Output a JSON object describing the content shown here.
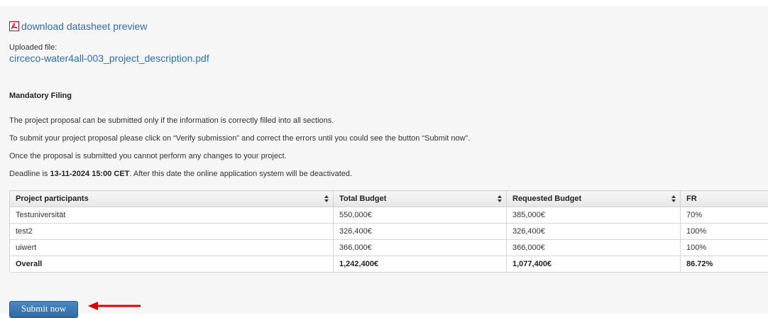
{
  "attachment": {
    "download_label": "download datasheet preview",
    "uploaded_label": "Uploaded file:",
    "file_name": "circeco-water4all-003_project_description.pdf"
  },
  "filing": {
    "title": "Mandatory Filing",
    "para1": "The project proposal can be submitted only if the information is correctly filled into all sections.",
    "para2": "To submit your project proposal please click on “Verify submission” and correct the errors until you could see the button “Submit now”.",
    "para3": "Once the proposal is submitted you cannot perform any changes to your project.",
    "deadline_prefix": "Deadline is ",
    "deadline_value": "13-11-2024 15:00 CET",
    "deadline_suffix": ". After this date the online application system will be deactivated."
  },
  "budget_table": {
    "headers": [
      "Project participants",
      "Total Budget",
      "Requested Budget",
      "FR"
    ],
    "rows": [
      [
        "Testuniversität",
        "550,000€",
        "385,000€",
        "70%"
      ],
      [
        "test2",
        "326,400€",
        "326,400€",
        "100%"
      ],
      [
        "uiwert",
        "366,000€",
        "366,000€",
        "100%"
      ]
    ],
    "total": [
      "Overall",
      "1,242,400€",
      "1,077,400€",
      "86.72%"
    ]
  },
  "actions": {
    "submit_label": "Submit now"
  },
  "colors": {
    "link": "#2a6ebb",
    "button": "#2f6aa3",
    "arrow": "#e00000",
    "pdf_icon": "#d0021b"
  },
  "icons": {
    "download": "pdf-icon",
    "sort": "sort-icon",
    "pointer": "red-arrow-icon"
  }
}
